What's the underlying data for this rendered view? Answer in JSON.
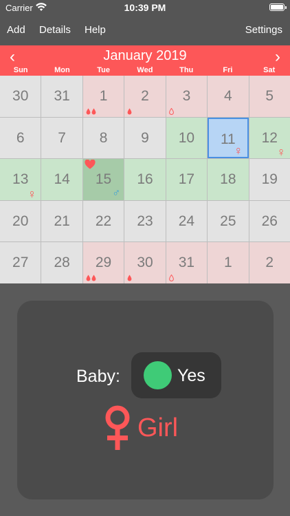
{
  "status_bar": {
    "carrier": "Carrier",
    "time": "10:39 PM"
  },
  "toolbar": {
    "add": "Add",
    "details": "Details",
    "help": "Help",
    "settings": "Settings"
  },
  "calendar": {
    "month_title": "January 2019",
    "prev": "‹",
    "next": "›",
    "weekdays": [
      "Sun",
      "Mon",
      "Tue",
      "Wed",
      "Thu",
      "Fri",
      "Sat"
    ],
    "days": [
      {
        "n": "30",
        "type": "plain"
      },
      {
        "n": "31",
        "type": "plain"
      },
      {
        "n": "1",
        "type": "period",
        "drops": 2
      },
      {
        "n": "2",
        "type": "period",
        "drops": 1
      },
      {
        "n": "3",
        "type": "period",
        "drops": 1,
        "outline": true
      },
      {
        "n": "4",
        "type": "period"
      },
      {
        "n": "5",
        "type": "period"
      },
      {
        "n": "6",
        "type": "plain"
      },
      {
        "n": "7",
        "type": "plain"
      },
      {
        "n": "8",
        "type": "plain"
      },
      {
        "n": "9",
        "type": "plain"
      },
      {
        "n": "10",
        "type": "fertile"
      },
      {
        "n": "11",
        "type": "selected",
        "symbol": "♀"
      },
      {
        "n": "12",
        "type": "fertile",
        "symbol": "♀"
      },
      {
        "n": "13",
        "type": "fertile",
        "symbol": "♀"
      },
      {
        "n": "14",
        "type": "fertile"
      },
      {
        "n": "15",
        "type": "ovulation",
        "heart": true,
        "symbol": "♂"
      },
      {
        "n": "16",
        "type": "fertile"
      },
      {
        "n": "17",
        "type": "fertile"
      },
      {
        "n": "18",
        "type": "fertile"
      },
      {
        "n": "19",
        "type": "plain"
      },
      {
        "n": "20",
        "type": "plain"
      },
      {
        "n": "21",
        "type": "plain"
      },
      {
        "n": "22",
        "type": "plain"
      },
      {
        "n": "23",
        "type": "plain"
      },
      {
        "n": "24",
        "type": "plain"
      },
      {
        "n": "25",
        "type": "plain"
      },
      {
        "n": "26",
        "type": "plain"
      },
      {
        "n": "27",
        "type": "plain"
      },
      {
        "n": "28",
        "type": "plain"
      },
      {
        "n": "29",
        "type": "period",
        "drops": 2
      },
      {
        "n": "30",
        "type": "period",
        "drops": 1
      },
      {
        "n": "31",
        "type": "period",
        "drops": 1,
        "outline": true
      },
      {
        "n": "1",
        "type": "period"
      },
      {
        "n": "2",
        "type": "period"
      }
    ]
  },
  "panel": {
    "baby_label": "Baby:",
    "toggle_value": "Yes",
    "gender": "Girl"
  },
  "colors": {
    "accent": "#fd5758",
    "toggle_on": "#3fcb77",
    "male": "#3a9fd8"
  }
}
